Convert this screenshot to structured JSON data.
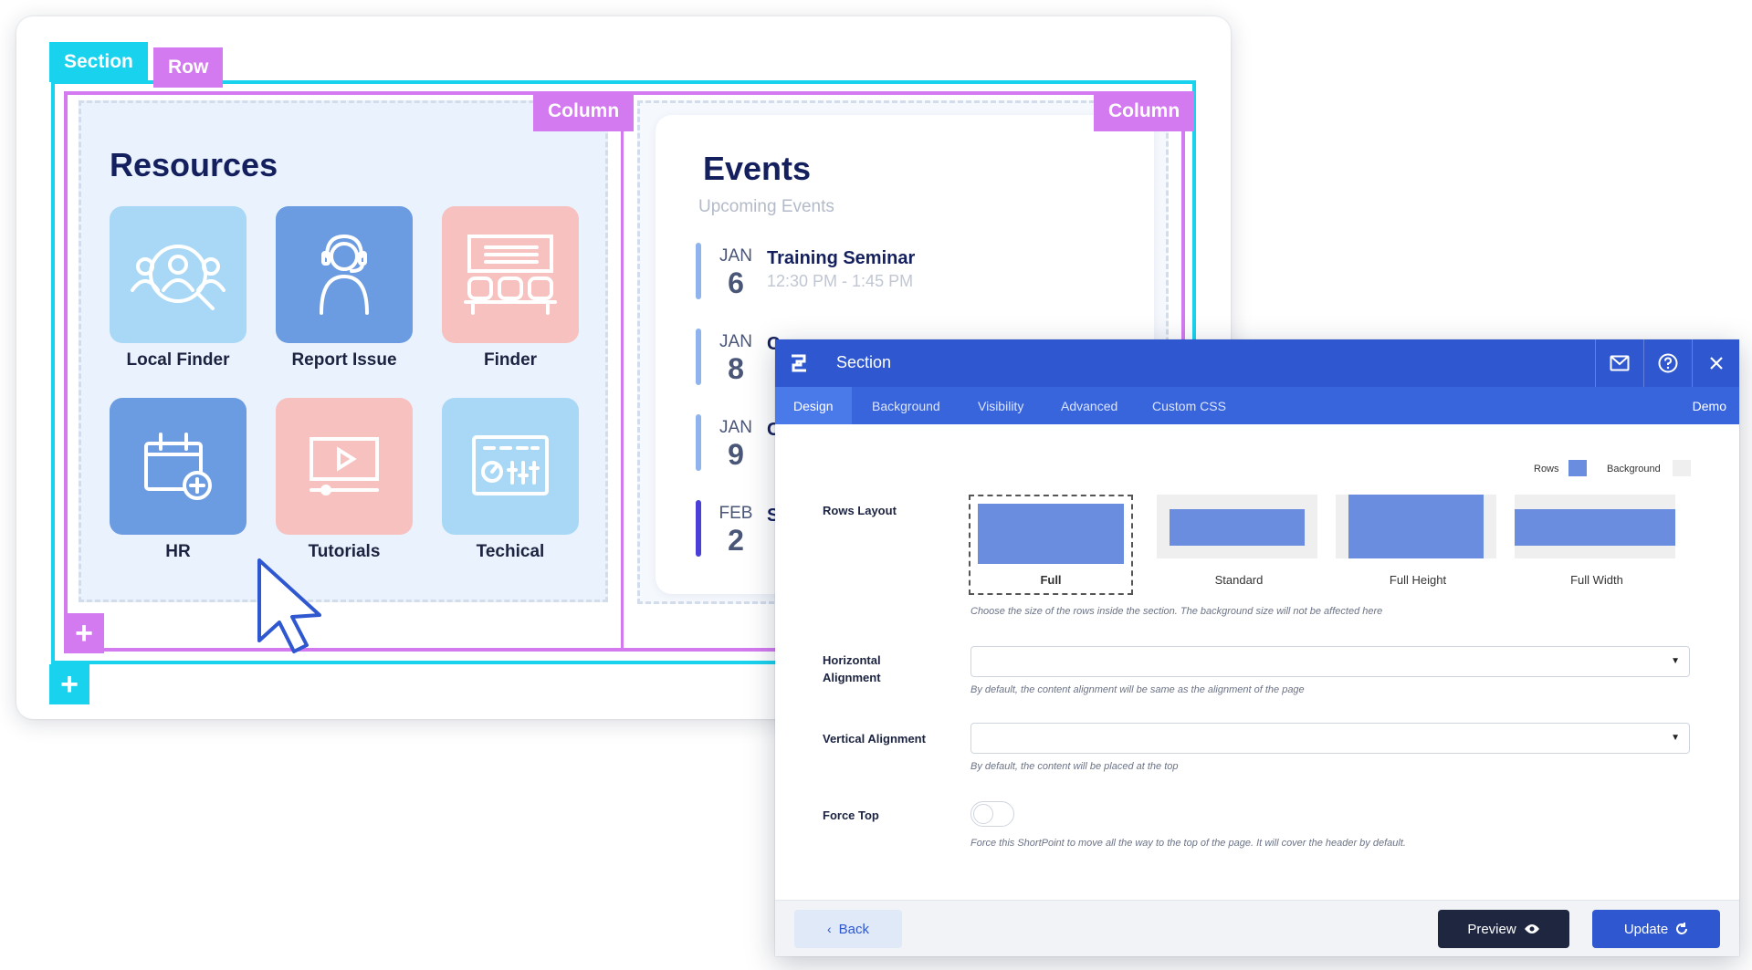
{
  "builder": {
    "section_tag": "Section",
    "row_tag": "Row",
    "column_tag_1": "Column",
    "column_tag_2": "Column"
  },
  "resources": {
    "title": "Resources",
    "tiles": [
      {
        "label": "Local Finder",
        "color": "#a9d8f6",
        "icon": "people-search-icon"
      },
      {
        "label": "Report Issue",
        "color": "#6b9be0",
        "icon": "support-agent-icon"
      },
      {
        "label": "Finder",
        "color": "#f6c1bf",
        "icon": "seats-icon"
      },
      {
        "label": "HR",
        "color": "#6b9be0",
        "icon": "calendar-add-icon"
      },
      {
        "label": "Tutorials",
        "color": "#f6c1bf",
        "icon": "video-player-icon"
      },
      {
        "label": "Techical",
        "color": "#a9d8f6",
        "icon": "dashboard-icon"
      }
    ]
  },
  "events": {
    "title": "Events",
    "subtitle": "Upcoming Events",
    "items": [
      {
        "month": "JAN",
        "day": "6",
        "name": "Training Seminar",
        "time": "12:30 PM - 1:45 PM",
        "bar_color": "#8fb3ec"
      },
      {
        "month": "JAN",
        "day": "8",
        "name": "C",
        "time": "",
        "bar_color": "#8fb3ec"
      },
      {
        "month": "JAN",
        "day": "9",
        "name": "C",
        "time": "",
        "bar_color": "#8fb3ec"
      },
      {
        "month": "FEB",
        "day": "2",
        "name": "S",
        "time": "",
        "bar_color": "#4a3fd6"
      }
    ]
  },
  "dialog": {
    "title": "Section",
    "tabs": [
      "Design",
      "Background",
      "Visibility",
      "Advanced",
      "Custom CSS"
    ],
    "active_tab": "Design",
    "demo_label": "Demo",
    "legend": {
      "rows": "Rows",
      "background": "Background",
      "rows_color": "#6b8de0",
      "background_color": "#efefef"
    },
    "rows_layout": {
      "label": "Rows Layout",
      "options": [
        "Full",
        "Standard",
        "Full Height",
        "Full Width"
      ],
      "selected": "Full",
      "hint": "Choose the size of the rows inside the section. The background size will not be affected here"
    },
    "horizontal_alignment": {
      "label": "Horizontal Alignment",
      "value": "",
      "hint": "By default, the content alignment will be same as the alignment of the page"
    },
    "vertical_alignment": {
      "label": "Vertical Alignment",
      "value": "",
      "hint": "By default, the content will be placed at the top"
    },
    "force_top": {
      "label": "Force Top",
      "enabled": false,
      "hint": "Force this ShortPoint to move all the way to the top of the page. It will cover the header by default."
    },
    "footer": {
      "back": "Back",
      "preview": "Preview",
      "update": "Update"
    }
  }
}
